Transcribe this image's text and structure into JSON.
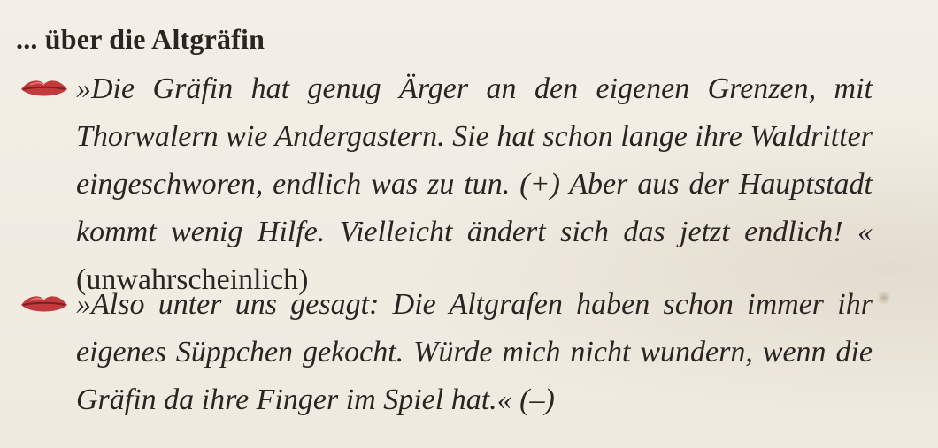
{
  "heading": "... über die Altgräfin",
  "bullet_icon": "lips-icon",
  "colors": {
    "paper": "#f1ede4",
    "text": "#2b2422",
    "lips": "#c23a3c"
  },
  "entries": [
    {
      "quote": "»Die Gräfin hat genug Ärger an den eigenen Grenzen, mit Thorwalern wie Andergastern. Sie hat schon lange ihre Waldritter eingeschworen, endlich was zu tun. (+) Aber aus der Hauptstadt kommt wenig Hilfe. Vielleicht ändert sich das jetzt endlich! «",
      "rating": "(unwahrscheinlich)"
    },
    {
      "quote": "»Also unter uns gesagt: Die Altgrafen haben schon immer ihr eigenes Süppchen gekocht. Würde mich nicht wundern, wenn die Gräfin da ihre Finger im Spiel hat.«",
      "rating": "(–)"
    }
  ]
}
